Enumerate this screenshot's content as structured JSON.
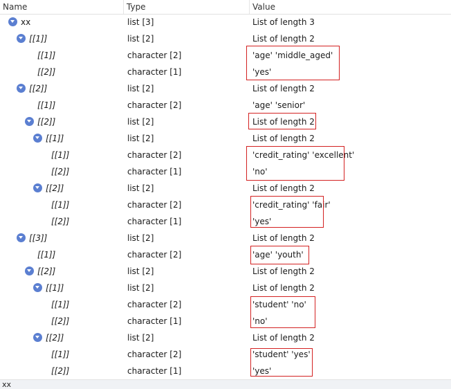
{
  "header": {
    "name": "Name",
    "type": "Type",
    "value": "Value"
  },
  "rows": [
    {
      "name": "xx",
      "type": "list [3]",
      "value": "List of length 3",
      "expandable": true
    },
    {
      "name": "[[1]]",
      "type": "list [2]",
      "value": "List of length 2",
      "expandable": true
    },
    {
      "name": "[[1]]",
      "type": "character [2]",
      "value": "'age' 'middle_aged'",
      "expandable": false
    },
    {
      "name": "[[2]]",
      "type": "character [1]",
      "value": "'yes'",
      "expandable": false
    },
    {
      "name": "[[2]]",
      "type": "list [2]",
      "value": "List of length 2",
      "expandable": true
    },
    {
      "name": "[[1]]",
      "type": "character [2]",
      "value": "'age' 'senior'",
      "expandable": false
    },
    {
      "name": "[[2]]",
      "type": "list [2]",
      "value": "List of length 2",
      "expandable": true
    },
    {
      "name": "[[1]]",
      "type": "list [2]",
      "value": "List of length 2",
      "expandable": true
    },
    {
      "name": "[[1]]",
      "type": "character [2]",
      "value": "'credit_rating' 'excellent'",
      "expandable": false
    },
    {
      "name": "[[2]]",
      "type": "character [1]",
      "value": "'no'",
      "expandable": false
    },
    {
      "name": "[[2]]",
      "type": "list [2]",
      "value": "List of length 2",
      "expandable": true
    },
    {
      "name": "[[1]]",
      "type": "character [2]",
      "value": "'credit_rating' 'fair'",
      "expandable": false
    },
    {
      "name": "[[2]]",
      "type": "character [1]",
      "value": "'yes'",
      "expandable": false
    },
    {
      "name": "[[3]]",
      "type": "list [2]",
      "value": "List of length 2",
      "expandable": true
    },
    {
      "name": "[[1]]",
      "type": "character [2]",
      "value": "'age' 'youth'",
      "expandable": false
    },
    {
      "name": "[[2]]",
      "type": "list [2]",
      "value": "List of length 2",
      "expandable": true
    },
    {
      "name": "[[1]]",
      "type": "list [2]",
      "value": "List of length 2",
      "expandable": true
    },
    {
      "name": "[[1]]",
      "type": "character [2]",
      "value": "'student' 'no'",
      "expandable": false
    },
    {
      "name": "[[2]]",
      "type": "character [1]",
      "value": "'no'",
      "expandable": false
    },
    {
      "name": "[[2]]",
      "type": "list [2]",
      "value": "List of length 2",
      "expandable": true
    },
    {
      "name": "[[1]]",
      "type": "character [2]",
      "value": "'student' 'yes'",
      "expandable": false
    },
    {
      "name": "[[2]]",
      "type": "character [1]",
      "value": "'yes'",
      "expandable": false
    }
  ],
  "status": {
    "text": "xx"
  },
  "colors": {
    "toggle": "#5b7fd1",
    "highlight_box": "#d32020"
  }
}
